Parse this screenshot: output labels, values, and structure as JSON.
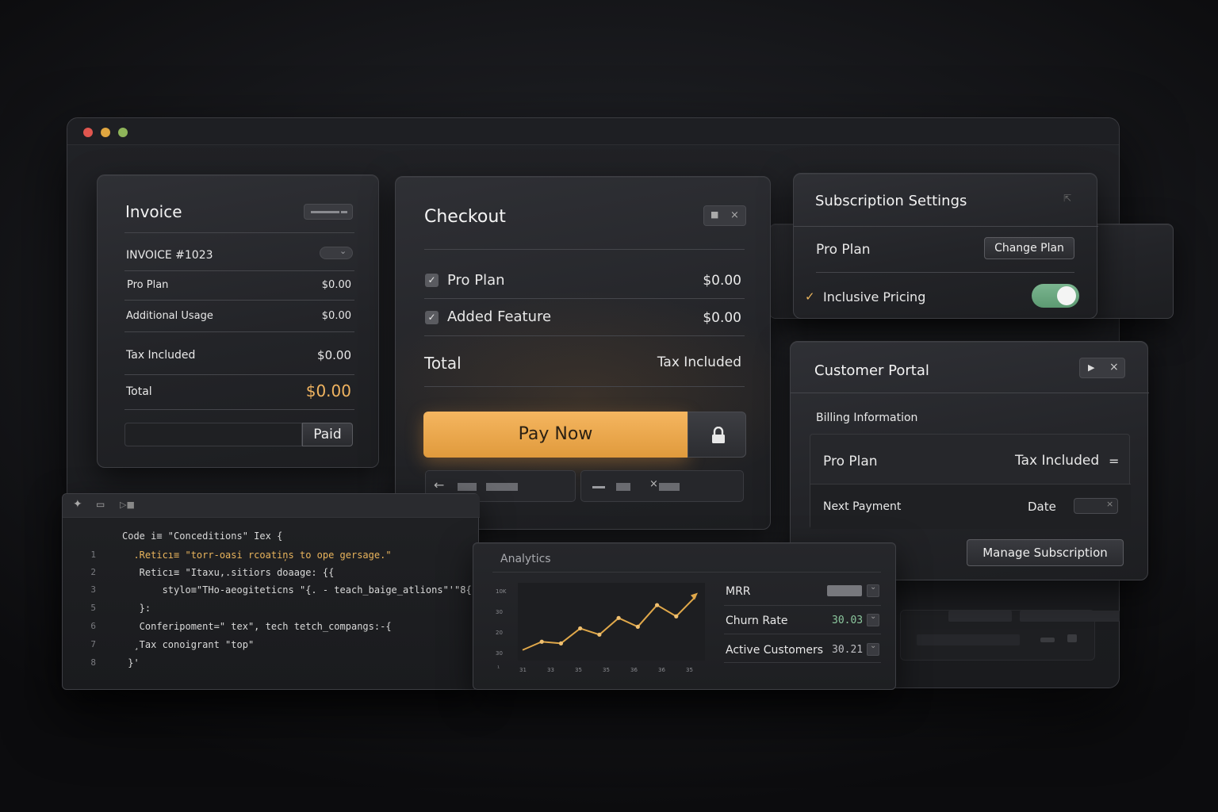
{
  "invoice": {
    "title": "Invoice",
    "number": "INVOICE #1023",
    "rows": [
      {
        "label": "Pro Plan",
        "value": "$0.00"
      },
      {
        "label": "Additional Usage",
        "value": "$0.00"
      },
      {
        "label": "Tax Included",
        "value": "$0.00"
      }
    ],
    "total_label": "Total",
    "total_value": "$0.00",
    "paid_label": "Paid"
  },
  "checkout": {
    "title": "Checkout",
    "items": [
      {
        "label": "Pro Plan",
        "value": "$0.00",
        "checked": true
      },
      {
        "label": "Added Feature",
        "value": "$0.00",
        "checked": true
      }
    ],
    "total_label": "Total",
    "total_value": "Tax Included",
    "pay_label": "Pay Now",
    "accent": "#eea94a"
  },
  "subscription": {
    "title": "Subscription Settings",
    "plan": "Pro Plan",
    "change_label": "Change Plan",
    "pricing_label": "Inclusive Pricing",
    "pricing_enabled": true,
    "toggle_color": "#6ea882"
  },
  "portal": {
    "title": "Customer Portal",
    "section": "Billing Information",
    "plan": "Pro Plan",
    "plan_value": "Tax Included",
    "next_label": "Next Payment",
    "next_value": "Date",
    "manage_label": "Manage Subscription"
  },
  "code": {
    "lines": [
      {
        "n": "",
        "text": "Code i≡ \"Conceditions\" Iex {"
      },
      {
        "n": "1",
        "text": "  .Reticı≡ \"torr-oasi rcoatiņs to ope gersage.\""
      },
      {
        "n": "2",
        "text": "   Reticı≡ \"Itaxu,.sitiors doaage: {{"
      },
      {
        "n": "3",
        "text": "       stylo≡\"THo-aeogiteticns \"{. - teach_baige_atlions\"'\"8{"
      },
      {
        "n": "5",
        "text": "   }:"
      },
      {
        "n": "6",
        "text": "   Conferipoment=\" tex\", tech tetch_compangs:-{"
      },
      {
        "n": "7",
        "text": "  ¸Tax conoigrant \"top\""
      },
      {
        "n": "8",
        "text": " }'"
      }
    ]
  },
  "analytics": {
    "title": "Analytics",
    "metrics": [
      {
        "label": "MRR",
        "value": ""
      },
      {
        "label": "Churn Rate",
        "value": "30.03"
      },
      {
        "label": "Active Customers",
        "value": "30.21"
      }
    ]
  },
  "chart_data": {
    "type": "line",
    "title": "",
    "y_ticks": [
      "10K",
      "30",
      "20",
      "30"
    ],
    "x_ticks": [
      "31",
      "33",
      "35",
      "35",
      "36",
      "36",
      "35"
    ],
    "values": [
      1,
      3,
      2.6,
      6.2,
      4.7,
      8.7,
      6.6,
      11.8,
      9.1,
      13.8
    ],
    "ylim": [
      0,
      16
    ],
    "color": "#e0a84a"
  }
}
